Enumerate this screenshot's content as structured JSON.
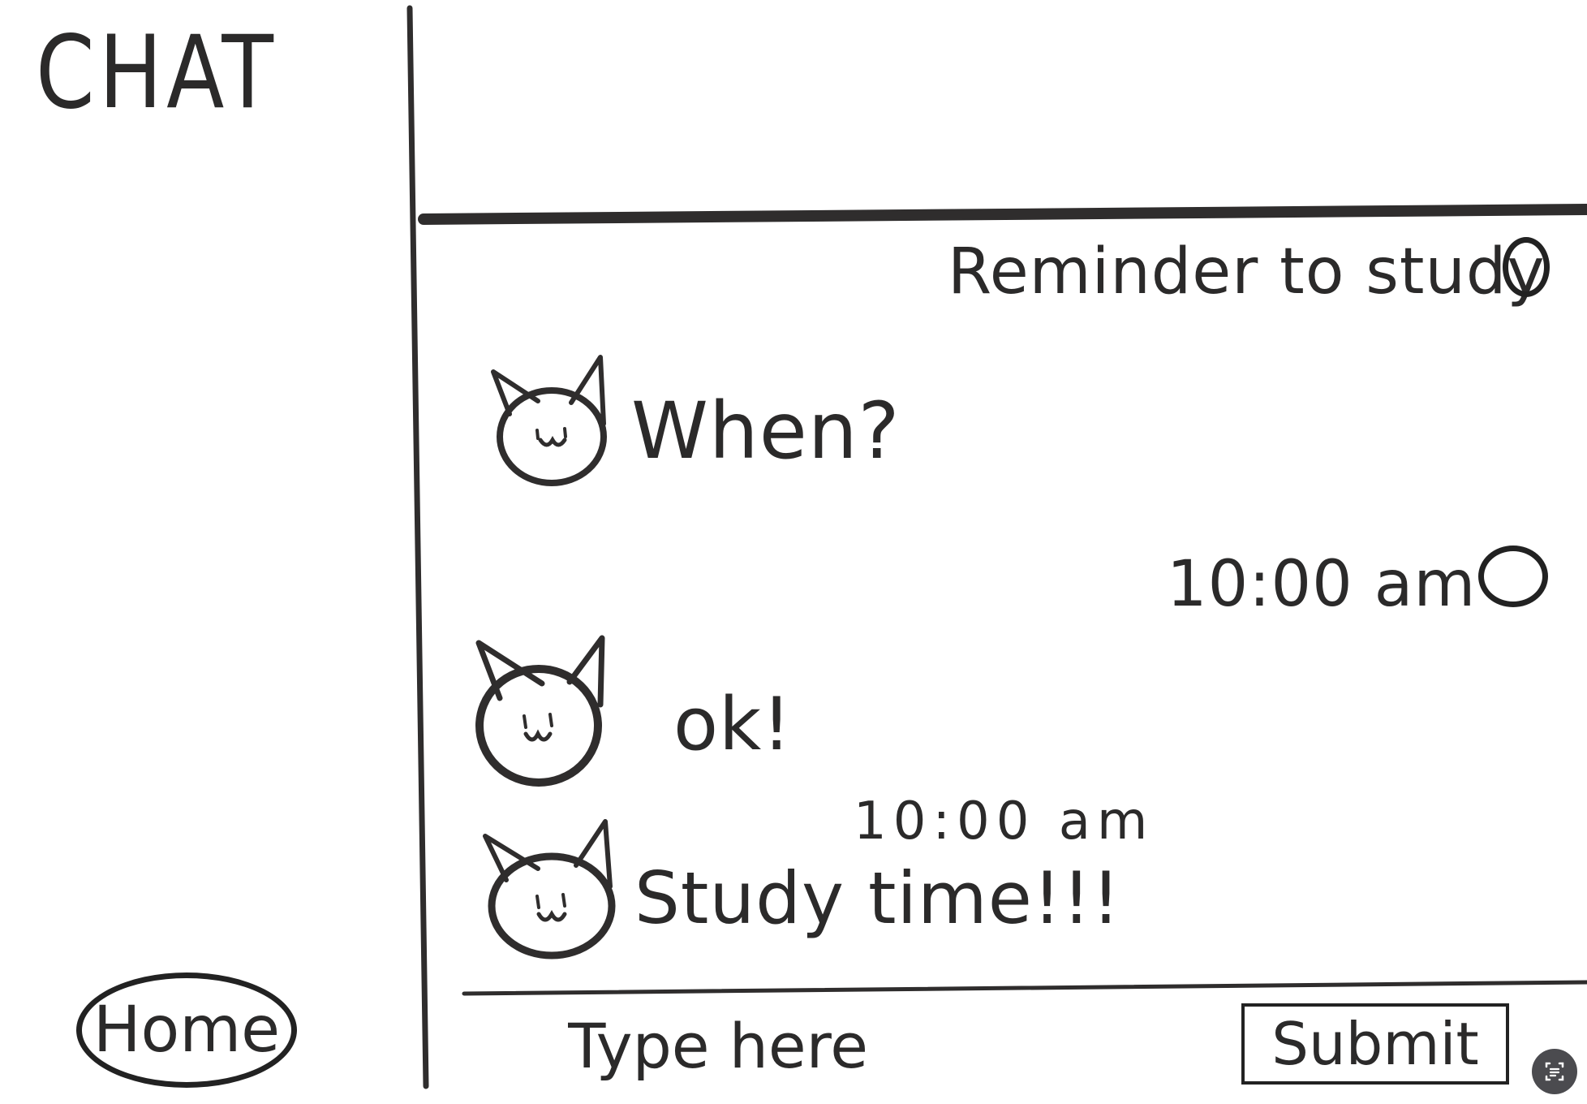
{
  "app": {
    "title": "CHAT"
  },
  "sidebar": {
    "home_label": "Home"
  },
  "messages": [
    {
      "sender": "me",
      "text": "Reminder to study"
    },
    {
      "sender": "bot",
      "text": "When?"
    },
    {
      "sender": "me",
      "text": "10:00 am"
    },
    {
      "sender": "bot",
      "text": "ok!"
    },
    {
      "sender": "bot",
      "time": "10:00 am",
      "text": "Study time!!!"
    }
  ],
  "composer": {
    "placeholder": "Type here",
    "submit_label": "Submit"
  },
  "icons": {
    "avatar": "cat-avatar-icon",
    "status": "circle-status-icon",
    "tool": "screenshot-tool-icon"
  },
  "colors": {
    "ink": "#2b2a2a",
    "paper": "#ffffff"
  }
}
